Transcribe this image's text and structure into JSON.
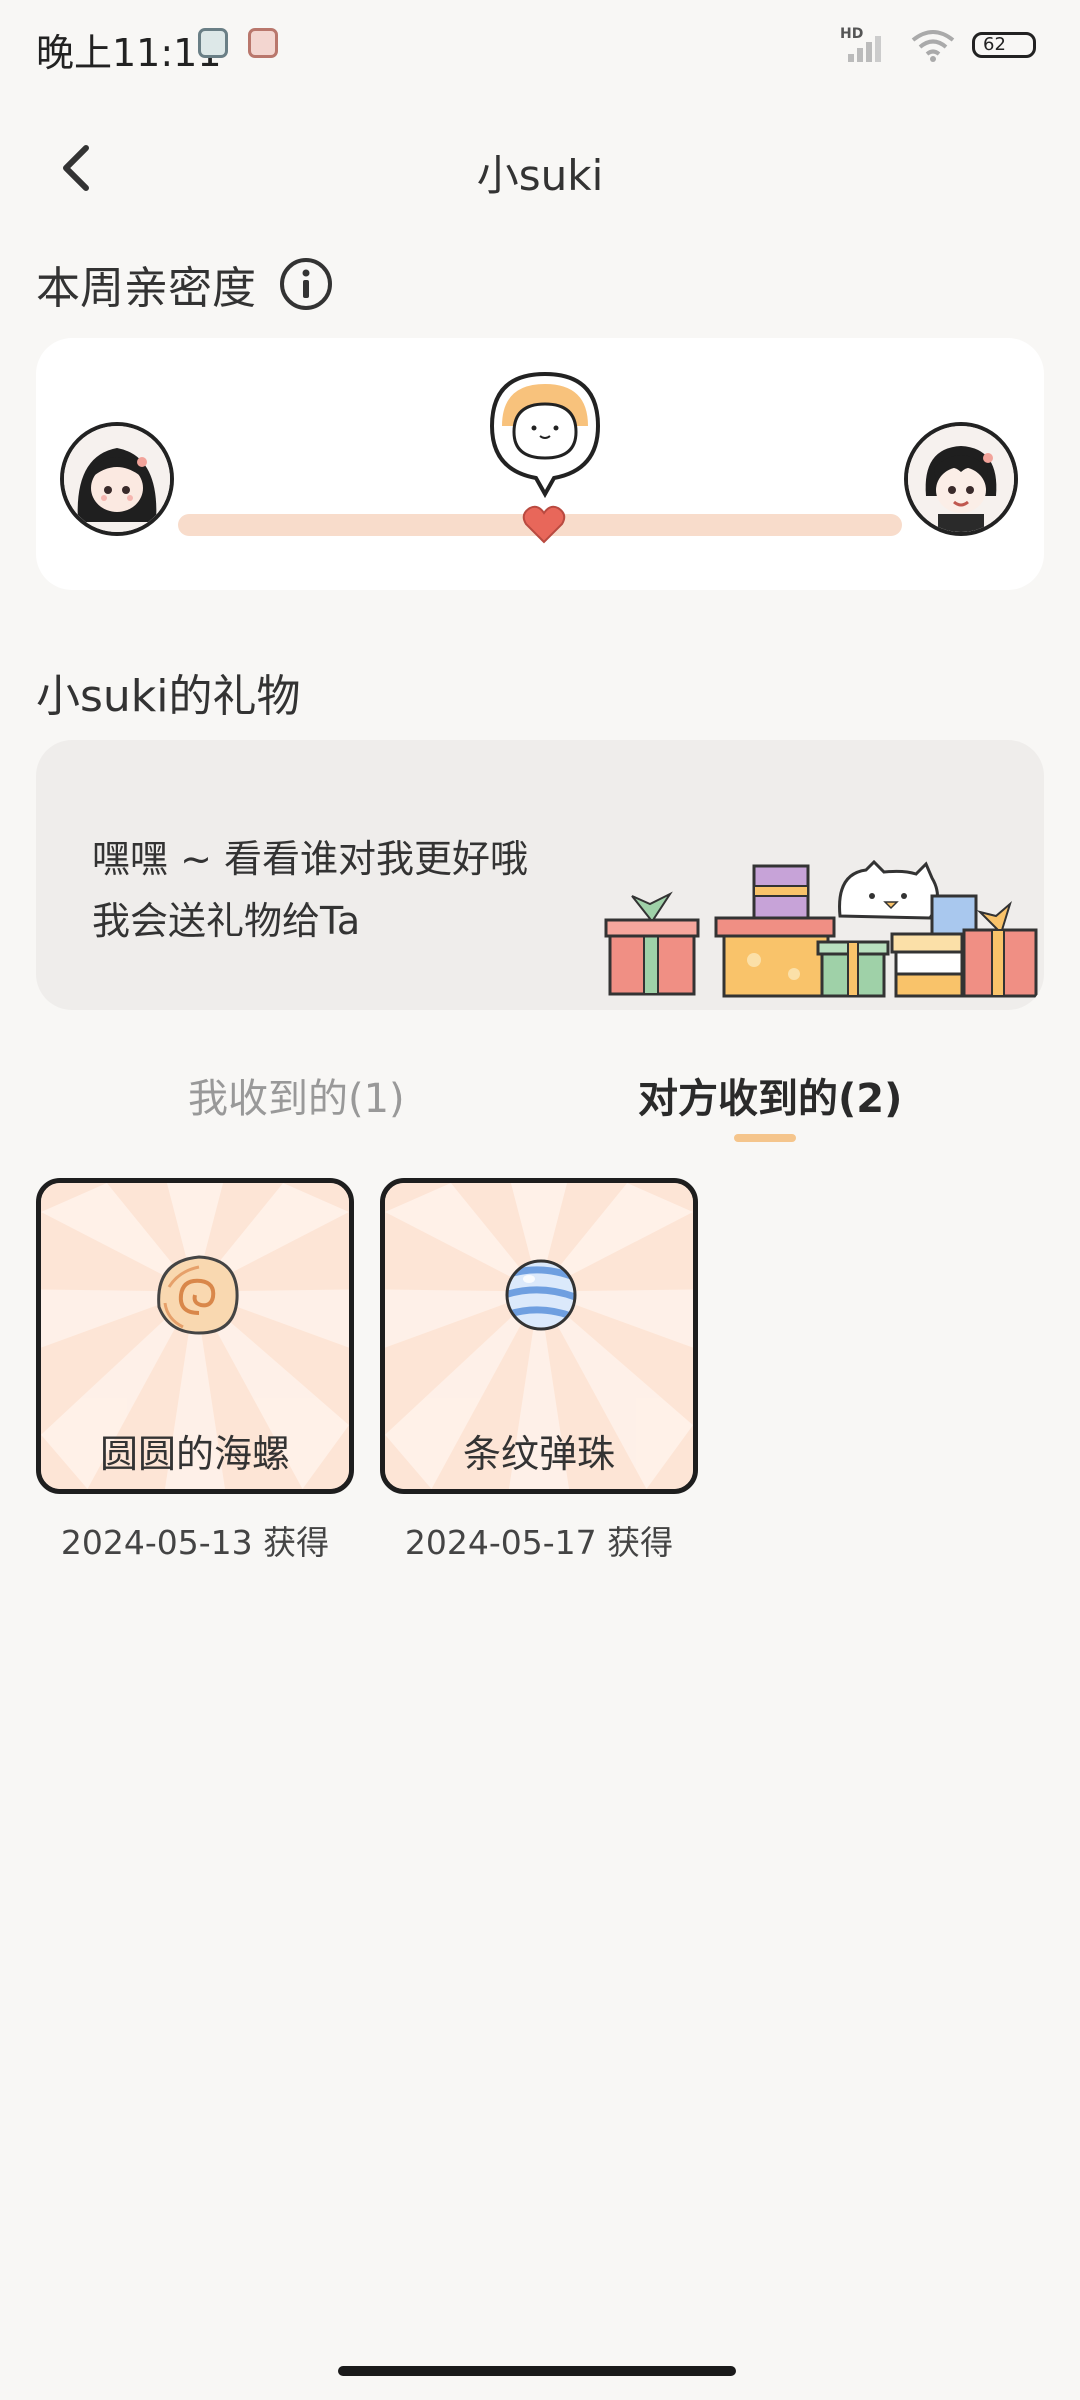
{
  "status_bar": {
    "time": "晚上11:11",
    "network_label": "HD",
    "battery": "62"
  },
  "header": {
    "title": "小suki"
  },
  "intimacy": {
    "title": "本周亲密度",
    "level": 0.5
  },
  "gifts": {
    "title": "小suki的礼物",
    "banner_line1": "嘿嘿 ~ 看看谁对我更好哦",
    "banner_line2": "我会送礼物给Ta"
  },
  "tabs": {
    "mine": "我收到的(1)",
    "theirs": "对方收到的(2)",
    "active": "theirs"
  },
  "gift_items": [
    {
      "name": "圆圆的海螺",
      "date": "2024-05-13 获得",
      "icon": "conch-shell-icon"
    },
    {
      "name": "条纹弹珠",
      "date": "2024-05-17 获得",
      "icon": "striped-marble-icon"
    }
  ],
  "colors": {
    "accent": "#f5c58c",
    "progress_track": "#f8dccb",
    "heart": "#e8675a"
  }
}
